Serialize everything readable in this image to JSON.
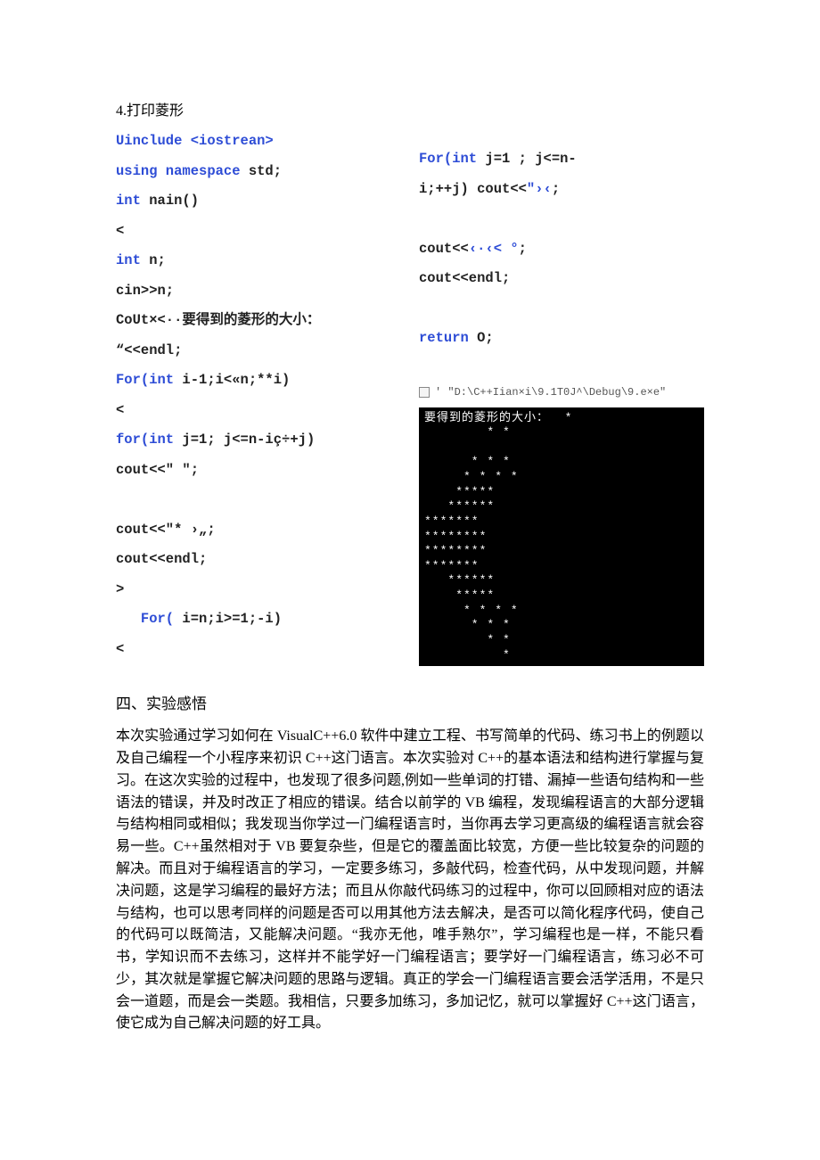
{
  "title": "4.打印菱形",
  "code_left": [
    {
      "segs": [
        {
          "t": "Uinclude ",
          "c": "kw"
        },
        {
          "t": "<iostrean>",
          "c": "kw"
        }
      ]
    },
    {
      "segs": [
        {
          "t": "using namespace ",
          "c": "kw"
        },
        {
          "t": "std;",
          "c": "pl"
        }
      ]
    },
    {
      "segs": [
        {
          "t": "int ",
          "c": "kw"
        },
        {
          "t": "nain()",
          "c": "pl"
        }
      ]
    },
    {
      "segs": [
        {
          "t": "<",
          "c": "pl"
        }
      ]
    },
    {
      "segs": [
        {
          "t": "int ",
          "c": "kw"
        },
        {
          "t": "n;",
          "c": "pl"
        }
      ]
    },
    {
      "segs": [
        {
          "t": "cin>>n;",
          "c": "pl"
        }
      ]
    },
    {
      "segs": [
        {
          "t": "CoUt×<··要得到的菱形的大小：",
          "c": "pl"
        }
      ]
    },
    {
      "segs": [
        {
          "t": "“<<endl;",
          "c": "pl"
        }
      ]
    },
    {
      "segs": [
        {
          "t": "For(int ",
          "c": "kw"
        },
        {
          "t": "i-1;i<«n;**i)",
          "c": "pl"
        }
      ]
    },
    {
      "segs": [
        {
          "t": "<",
          "c": "pl"
        }
      ]
    },
    {
      "segs": [
        {
          "t": "for(int ",
          "c": "kw"
        },
        {
          "t": "j=1; j<=n-iç÷+j)",
          "c": "pl"
        }
      ]
    },
    {
      "segs": [
        {
          "t": "cout<<\" \";",
          "c": "pl"
        }
      ]
    },
    {
      "segs": [
        {
          "t": " ",
          "c": "pl"
        }
      ]
    },
    {
      "segs": [
        {
          "t": "cout<<\"* ›„;",
          "c": "pl"
        }
      ]
    },
    {
      "segs": [
        {
          "t": "cout<<endl;",
          "c": "pl"
        }
      ]
    },
    {
      "segs": [
        {
          "t": ">",
          "c": "pl"
        }
      ]
    },
    {
      "segs": [
        {
          "t": "   For( ",
          "c": "kw"
        },
        {
          "t": "i=n;i>=1;-i)",
          "c": "pl"
        }
      ]
    },
    {
      "segs": [
        {
          "t": "<",
          "c": "pl"
        }
      ]
    }
  ],
  "code_right": [
    {
      "segs": [
        {
          "t": "For(int ",
          "c": "kw"
        },
        {
          "t": "j=1 ; j<=n-",
          "c": "pl"
        }
      ]
    },
    {
      "segs": [
        {
          "t": "i;++j) cout<<",
          "c": "pl"
        },
        {
          "t": "\"›‹",
          "c": "kw"
        },
        {
          "t": ";",
          "c": "pl"
        }
      ]
    },
    {
      "segs": [
        {
          "t": " ",
          "c": "pl"
        }
      ]
    },
    {
      "segs": [
        {
          "t": "cout<<",
          "c": "pl"
        },
        {
          "t": "‹·‹< °",
          "c": "kw"
        },
        {
          "t": ";",
          "c": "pl"
        }
      ]
    },
    {
      "segs": [
        {
          "t": "cout<<endl;",
          "c": "pl"
        }
      ]
    },
    {
      "segs": [
        {
          "t": " ",
          "c": "pl"
        }
      ]
    },
    {
      "segs": [
        {
          "t": "return ",
          "c": "kw"
        },
        {
          "t": "O;",
          "c": "pl"
        }
      ]
    }
  ],
  "console_caption": "' \"D:\\C++Iian×i\\9.1T0J^\\Debug\\9.e×e\"",
  "console_lines": [
    "要得到的菱形的大小：  *",
    "        * *",
    "",
    "      * * *",
    "     * * * *",
    "    *****",
    "   ******",
    "*******",
    "********",
    "********",
    "*******",
    "   ******",
    "    *****",
    "     * * * *",
    "      * * *",
    "        * *",
    "          *"
  ],
  "section_heading": "四、实验感悟",
  "essay": "本次实验通过学习如何在 VisualC++6.0 软件中建立工程、书写简单的代码、练习书上的例题以及自己编程一个小程序来初识 C++这门语言。本次实验对 C++的基本语法和结构进行掌握与复习。在这次实验的过程中，也发现了很多问题,例如一些单词的打错、漏掉一些语句结构和一些语法的错误，并及时改正了相应的错误。结合以前学的 VB 编程，发现编程语言的大部分逻辑与结构相同或相似；我发现当你学过一门编程语言时，当你再去学习更高级的编程语言就会容易一些。C++虽然相对于 VB 要复杂些，但是它的覆盖面比较宽，方便一些比较复杂的问题的解决。而且对于编程语言的学习，一定要多练习，多敲代码，检查代码，从中发现问题，并解决问题，这是学习编程的最好方法；而且从你敲代码练习的过程中，你可以回顾相对应的语法与结构，也可以思考同样的问题是否可以用其他方法去解决，是否可以简化程序代码，使自己的代码可以既简洁，又能解决问题。“我亦无他，唯手熟尔”，学习编程也是一样，不能只看书，学知识而不去练习，这样并不能学好一门编程语言；要学好一门编程语言，练习必不可少，其次就是掌握它解决问题的思路与逻辑。真正的学会一门编程语言要会活学活用，不是只会一道题，而是会一类题。我相信，只要多加练习，多加记忆，就可以掌握好 C++这门语言，使它成为自己解决问题的好工具。"
}
